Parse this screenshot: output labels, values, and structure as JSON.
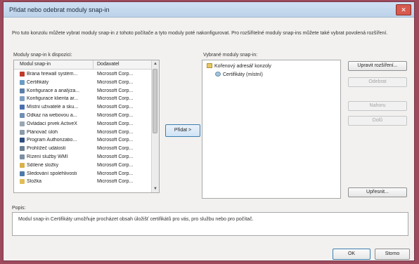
{
  "window": {
    "title": "Přidat nebo odebrat moduly snap-in",
    "close_label": "✕",
    "description": "Pro tuto konzolu můžete vybrat moduly snap-in z tohoto počítače a tyto moduly poté nakonfigurovat. Pro rozšiřitelné moduly snap-ins můžete také vybrat povolená rozšíření."
  },
  "available": {
    "label": "Moduly snap-in k dispozici:",
    "columns": [
      "Modul snap-in",
      "Dodavatel"
    ],
    "rows": [
      {
        "name": "Brána firewall systém...",
        "vendor": "Microsoft Corp...",
        "icon": "firewall-icon",
        "color": "#c0392b"
      },
      {
        "name": "Certifikáty",
        "vendor": "Microsoft Corp...",
        "icon": "certificate-icon",
        "color": "#6a9cc4"
      },
      {
        "name": "Konfigurace a analýza...",
        "vendor": "Microsoft Corp...",
        "icon": "security-config-icon",
        "color": "#5c7fa8"
      },
      {
        "name": "Konfigurace klienta ar...",
        "vendor": "Microsoft Corp...",
        "icon": "client-config-icon",
        "color": "#7d9ec2"
      },
      {
        "name": "Místní uživatelé a sku...",
        "vendor": "Microsoft Corp...",
        "icon": "users-icon",
        "color": "#4b6fb0"
      },
      {
        "name": "Odkaz na webovou a...",
        "vendor": "Microsoft Corp...",
        "icon": "web-link-icon",
        "color": "#6f8fb5"
      },
      {
        "name": "Ovládací prvek ActiveX",
        "vendor": "Microsoft Corp...",
        "icon": "activex-icon",
        "color": "#9aa6b2"
      },
      {
        "name": "Plánovač úloh",
        "vendor": "Microsoft Corp...",
        "icon": "task-scheduler-icon",
        "color": "#8a9bab"
      },
      {
        "name": "Program Authorizatio...",
        "vendor": "Microsoft Corp...",
        "icon": "authorization-icon",
        "color": "#2f4f7f"
      },
      {
        "name": "Prohlížeč událostí",
        "vendor": "Microsoft Corp...",
        "icon": "event-viewer-icon",
        "color": "#6b7f93"
      },
      {
        "name": "Řízení služby WMI",
        "vendor": "Microsoft Corp...",
        "icon": "wmi-icon",
        "color": "#7b8fa4"
      },
      {
        "name": "Sdílené složky",
        "vendor": "Microsoft Corp...",
        "icon": "shared-folder-icon",
        "color": "#d8b24a"
      },
      {
        "name": "Sledování spolehlivosti",
        "vendor": "Microsoft Corp...",
        "icon": "reliability-icon",
        "color": "#4d7aa8"
      },
      {
        "name": "Složka",
        "vendor": "Microsoft Corp...",
        "icon": "folder-icon",
        "color": "#e0be56"
      }
    ]
  },
  "add_button": "Přidat >",
  "selected": {
    "label": "Vybrané moduly snap-in:",
    "root": "Kořenový adresář konzoly",
    "child": "Certifikáty (místní)"
  },
  "buttons": {
    "edit_extensions": "Upravit rozšíření...",
    "remove": "Odebrat",
    "move_up": "Nahoru",
    "move_down": "Dolů",
    "advanced": "Upřesnit...",
    "ok": "OK",
    "cancel": "Storno"
  },
  "description_panel": {
    "label": "Popis:",
    "text": "Modul snap-in Certifikáty umožňuje procházet obsah úložišť certifikátů pro vás, pro službu nebo pro počítač."
  }
}
